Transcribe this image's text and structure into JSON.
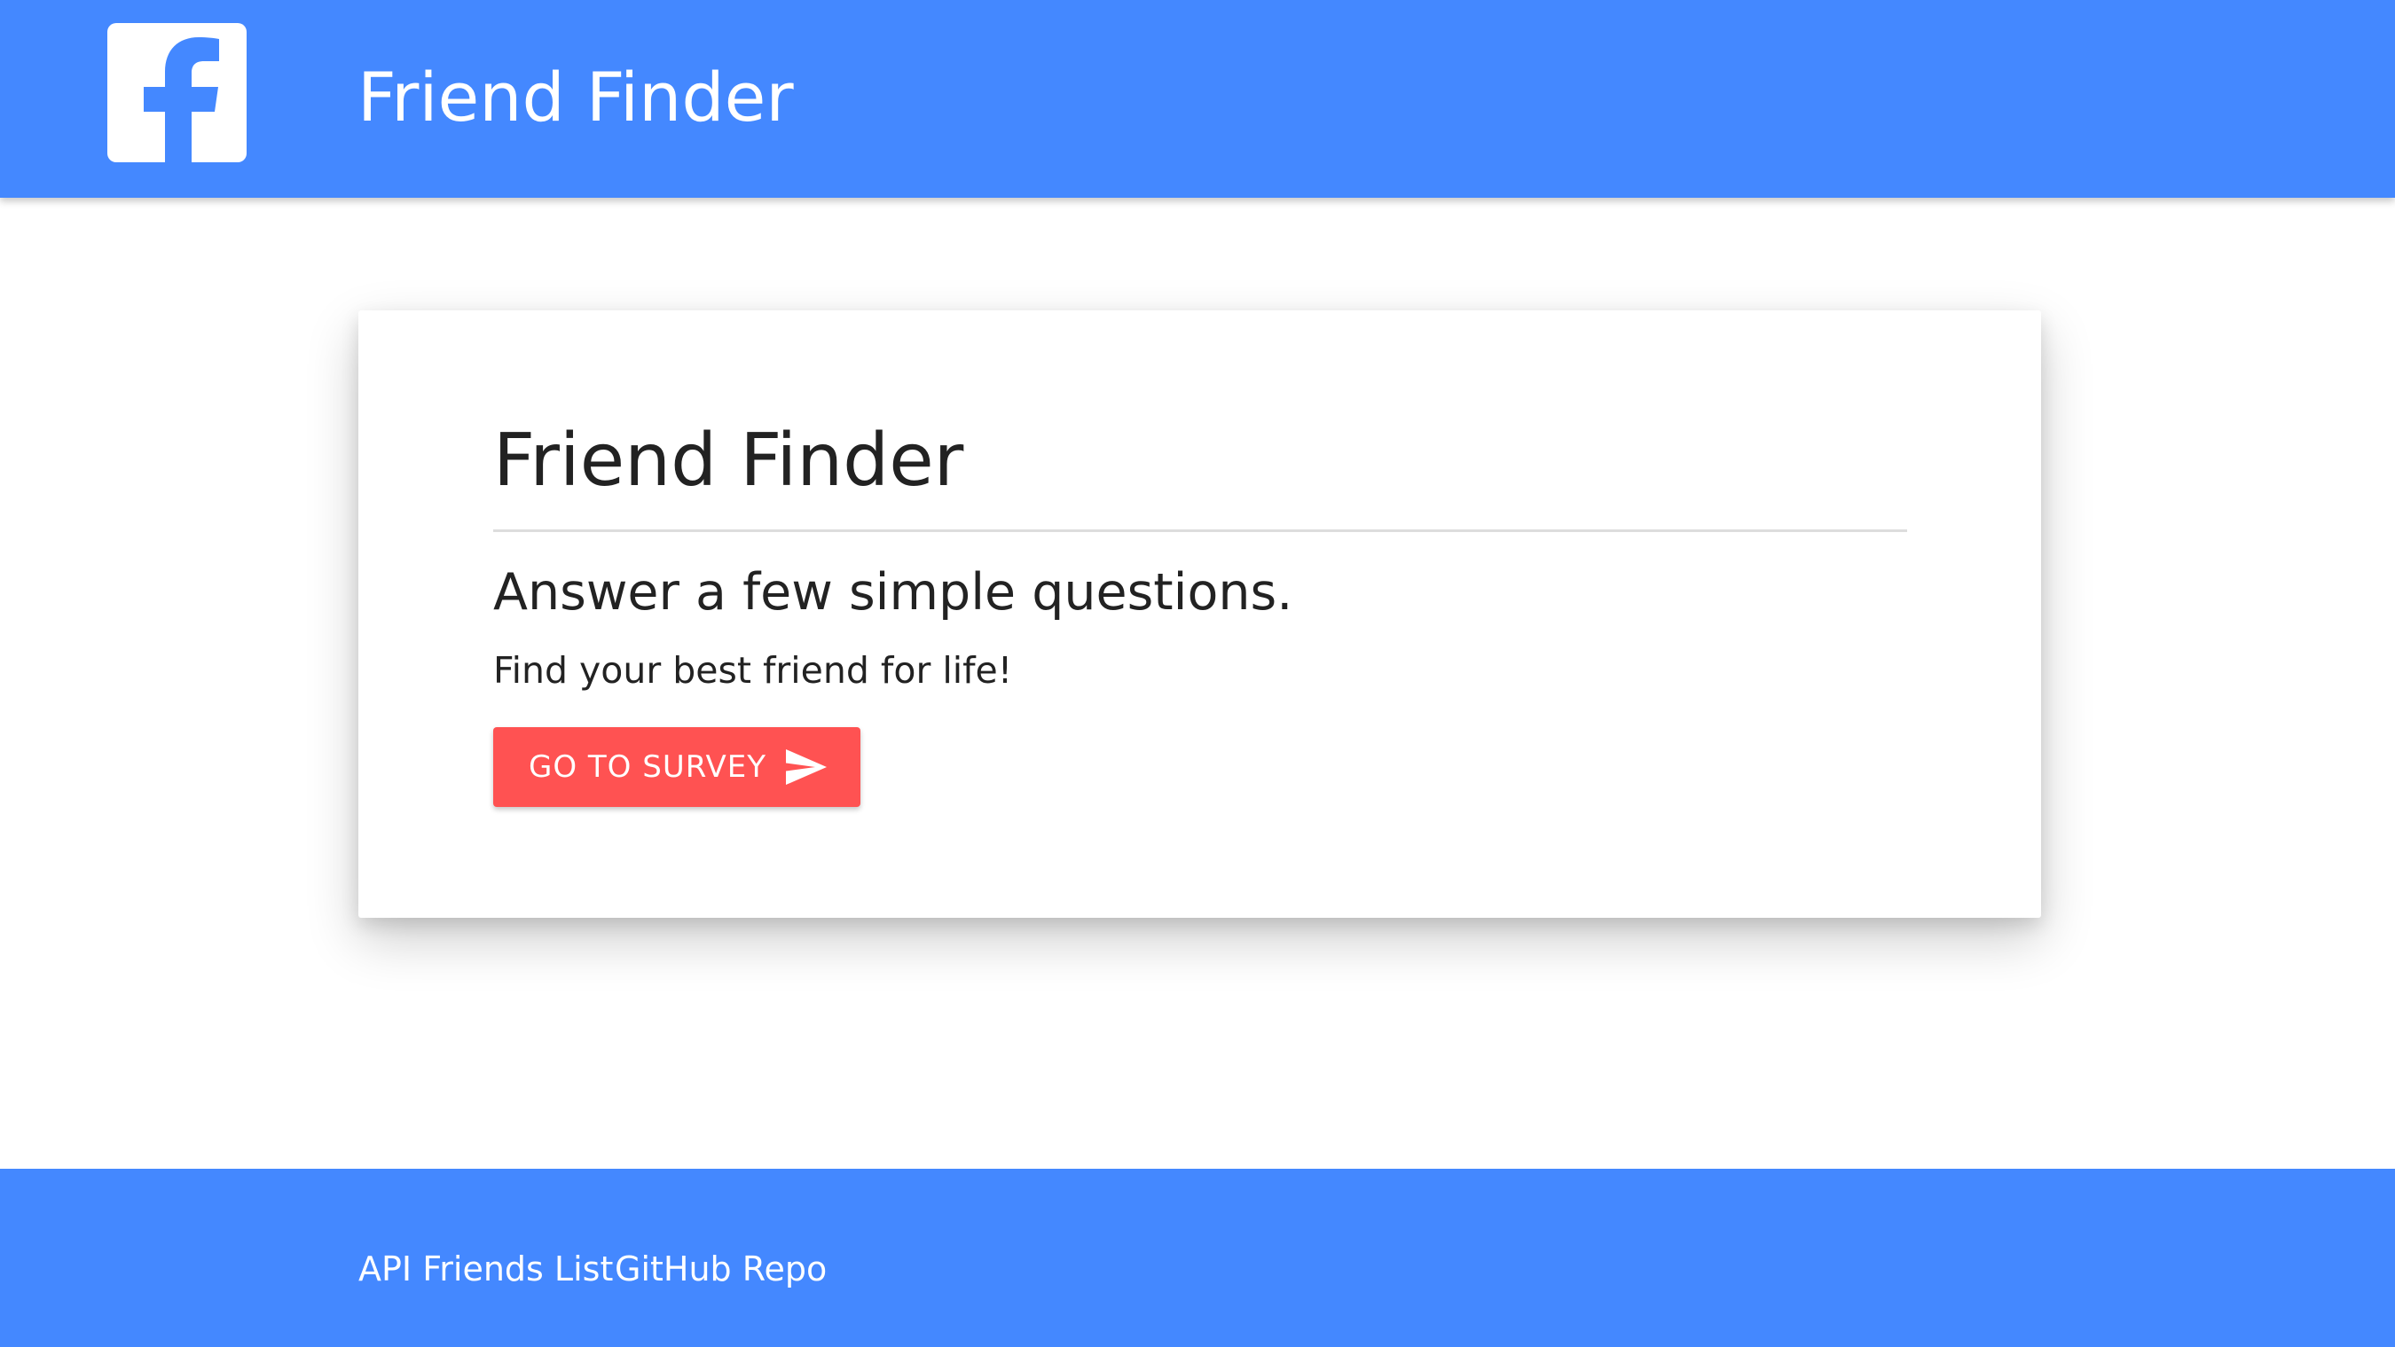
{
  "header": {
    "logo_icon": "facebook-f-icon",
    "title": "Friend Finder"
  },
  "card": {
    "heading": "Friend Finder",
    "subheading": "Answer a few simple questions.",
    "text": "Find your best friend for life!",
    "button_label": "GO TO SURVEY",
    "button_icon": "send-icon"
  },
  "footer": {
    "links": [
      {
        "label": "API Friends List"
      },
      {
        "label": "GitHub Repo"
      }
    ]
  },
  "colors": {
    "brand_blue": "#4488ff",
    "button_red": "#ff5252",
    "text_dark": "#222222"
  }
}
